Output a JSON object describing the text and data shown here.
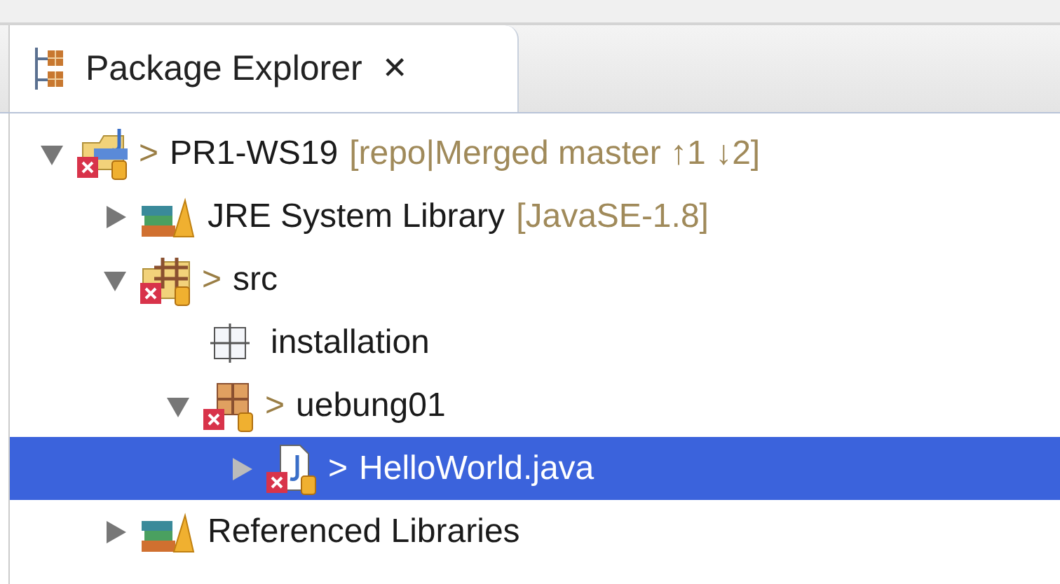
{
  "view": {
    "title": "Package Explorer",
    "close_glyph": "✕"
  },
  "tree": [
    {
      "kind": "project",
      "label": "PR1-WS19",
      "dirty": true,
      "error": true,
      "decoration": "[repo|Merged master ↑1 ↓2]",
      "expanded": true,
      "selected": false,
      "children": [
        {
          "kind": "library",
          "label": "JRE System Library",
          "dirty": false,
          "error": false,
          "decoration": "[JavaSE-1.8]",
          "expanded": false,
          "selected": false
        },
        {
          "kind": "source-folder",
          "label": "src",
          "dirty": true,
          "error": true,
          "expanded": true,
          "selected": false,
          "children": [
            {
              "kind": "empty-package",
              "label": "installation",
              "dirty": false,
              "error": false,
              "selected": false
            },
            {
              "kind": "package",
              "label": "uebung01",
              "dirty": true,
              "error": true,
              "expanded": true,
              "selected": false,
              "children": [
                {
                  "kind": "java-file",
                  "label": "HelloWorld.java",
                  "dirty": true,
                  "error": true,
                  "expanded": false,
                  "selected": true
                }
              ]
            }
          ]
        },
        {
          "kind": "library",
          "label": "Referenced Libraries",
          "dirty": false,
          "error": false,
          "expanded": false,
          "selected": false
        }
      ]
    }
  ],
  "dirty_marker": ">"
}
